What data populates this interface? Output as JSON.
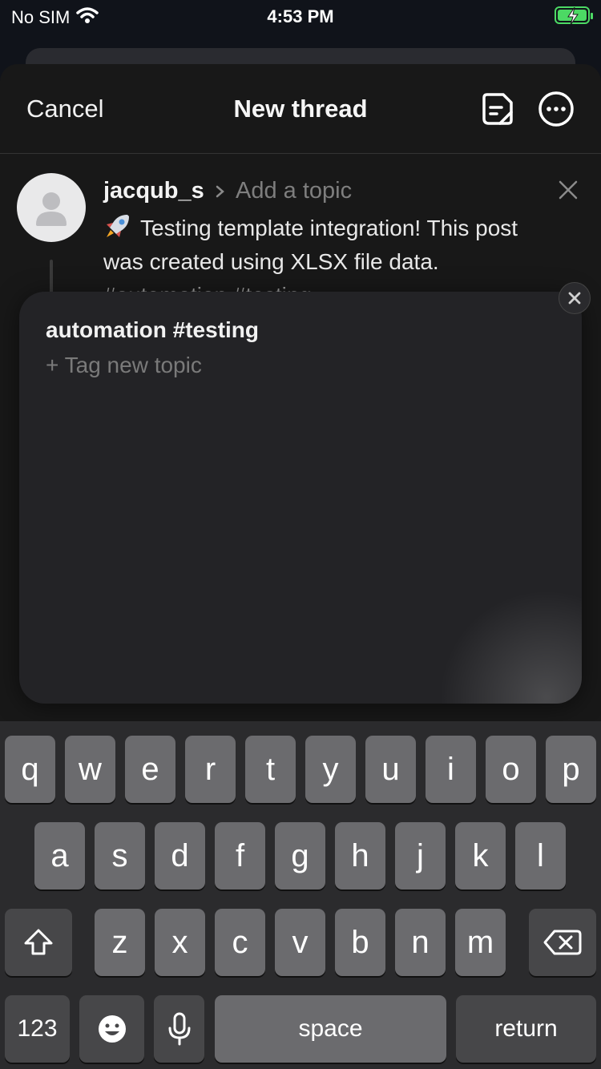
{
  "status": {
    "carrier": "No SIM",
    "time": "4:53 PM"
  },
  "nav": {
    "cancel": "Cancel",
    "title": "New thread"
  },
  "post": {
    "username": "jacqub_s",
    "topic_placeholder": "Add a topic",
    "text_line1": "Testing template integration! This post",
    "text_line2": "was created using XLSX file data.",
    "text_line3": "#automation #testing"
  },
  "suggest": {
    "item": "automation #testing",
    "new_topic": "+ Tag new topic"
  },
  "keyboard": {
    "row1": [
      "q",
      "w",
      "e",
      "r",
      "t",
      "y",
      "u",
      "i",
      "o",
      "p"
    ],
    "row2": [
      "a",
      "s",
      "d",
      "f",
      "g",
      "h",
      "j",
      "k",
      "l"
    ],
    "row3": [
      "z",
      "x",
      "c",
      "v",
      "b",
      "n",
      "m"
    ],
    "numbers": "123",
    "space": "space",
    "return": "return"
  },
  "colors": {
    "battery": "#4cd964",
    "background": "#181818",
    "popup": "#232326"
  },
  "icons": [
    "wifi-icon",
    "battery-charging-icon",
    "drafts-icon",
    "more-icon",
    "close-icon",
    "chevron-right-icon",
    "rocket-emoji",
    "shift-icon",
    "backspace-icon",
    "emoji-icon",
    "microphone-icon"
  ]
}
